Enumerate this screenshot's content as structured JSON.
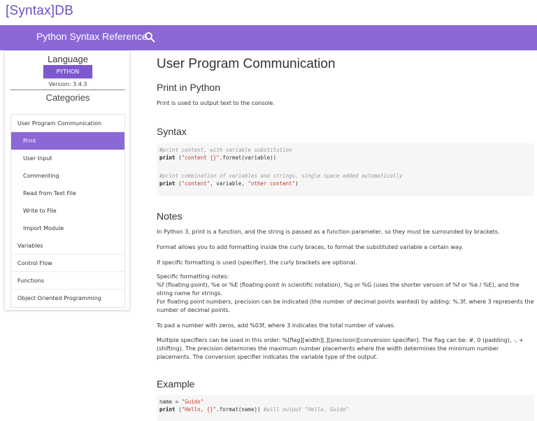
{
  "brand": "[Syntax]DB",
  "header": {
    "title": "Python Syntax Reference"
  },
  "sidebar": {
    "language_heading": "Language",
    "language_button": "PYTHON",
    "version": "Version: 3.4.3",
    "categories_heading": "Categories",
    "items": [
      {
        "label": "User Program Communication",
        "level": 0,
        "active": false
      },
      {
        "label": "Print",
        "level": 1,
        "active": true
      },
      {
        "label": "User Input",
        "level": 1,
        "active": false
      },
      {
        "label": "Commenting",
        "level": 1,
        "active": false
      },
      {
        "label": "Read from Text File",
        "level": 1,
        "active": false
      },
      {
        "label": "Write to File",
        "level": 1,
        "active": false
      },
      {
        "label": "Import Module",
        "level": 1,
        "active": false
      },
      {
        "label": "Variables",
        "level": 0,
        "active": false
      },
      {
        "label": "Control Flow",
        "level": 0,
        "active": false
      },
      {
        "label": "Functions",
        "level": 0,
        "active": false
      },
      {
        "label": "Object Oriented Programming",
        "level": 0,
        "active": false
      }
    ]
  },
  "content": {
    "title": "User Program Communication",
    "print_heading": "Print in Python",
    "print_desc": "Print is used to output text to the console.",
    "syntax_heading": "Syntax",
    "syntax_code": {
      "comment1": "#print content, with variable substitution",
      "line1_kw": "print",
      "line1_a": " (",
      "line1_str": "\"content {}\"",
      "line1_b": ".format(variable))",
      "comment2": "#print combination of variables and strings, single space added automatically",
      "line2_kw": "print",
      "line2_a": " (",
      "line2_str1": "\"content\"",
      "line2_b": ", variable, ",
      "line2_str2": "\"other content\"",
      "line2_c": ")"
    },
    "notes_heading": "Notes",
    "notes": [
      "In Python 3, print is a function, and the string is passed as a function parameter, so they must be surrounded by brackets.",
      "Format allows you to add formatting inside the curly braces, to format the substituted variable a certain way.",
      "If specific formatting is used (specifier), the curly brackets are optional.",
      "Specific formatting notes:",
      "%f (floating-point), %e or %E (floating-point in scientific notation), %g or %G (uses the shorter version of %f or %e / %E), and the string name for strings.",
      "For floating point numbers, precision can be indicated (the number of decimal points wanted) by adding: %.3f, where 3 represents the number of decimal points.",
      "To pad a number with zeros, add %03f, where 3 indicates the total number of values.",
      "Multiple specifiers can be used in this order: %[flag][width][.][precision][conversion specifier]. The flag can be: #, 0 (padding), -, + (shifting). The precision determines the maximum number placements where the width determines the minimum number placements. The conversion specifier indicates the variable type of the output."
    ],
    "example_heading": "Example",
    "example_code": {
      "l1_a": "name = ",
      "l1_str": "\"Guido\"",
      "l2_kw": "print",
      "l2_a": " (",
      "l2_str": "\"Hello, {}\"",
      "l2_b": ".format(name)) ",
      "l2_comment": "#will output \"Hello, Guido\""
    }
  },
  "colors": {
    "accent": "#8c67d6",
    "button": "#7e58cf",
    "brand": "#6b4fc4",
    "string": "#c0392b",
    "comment": "#999999"
  },
  "icons": {
    "search": "search-icon"
  }
}
